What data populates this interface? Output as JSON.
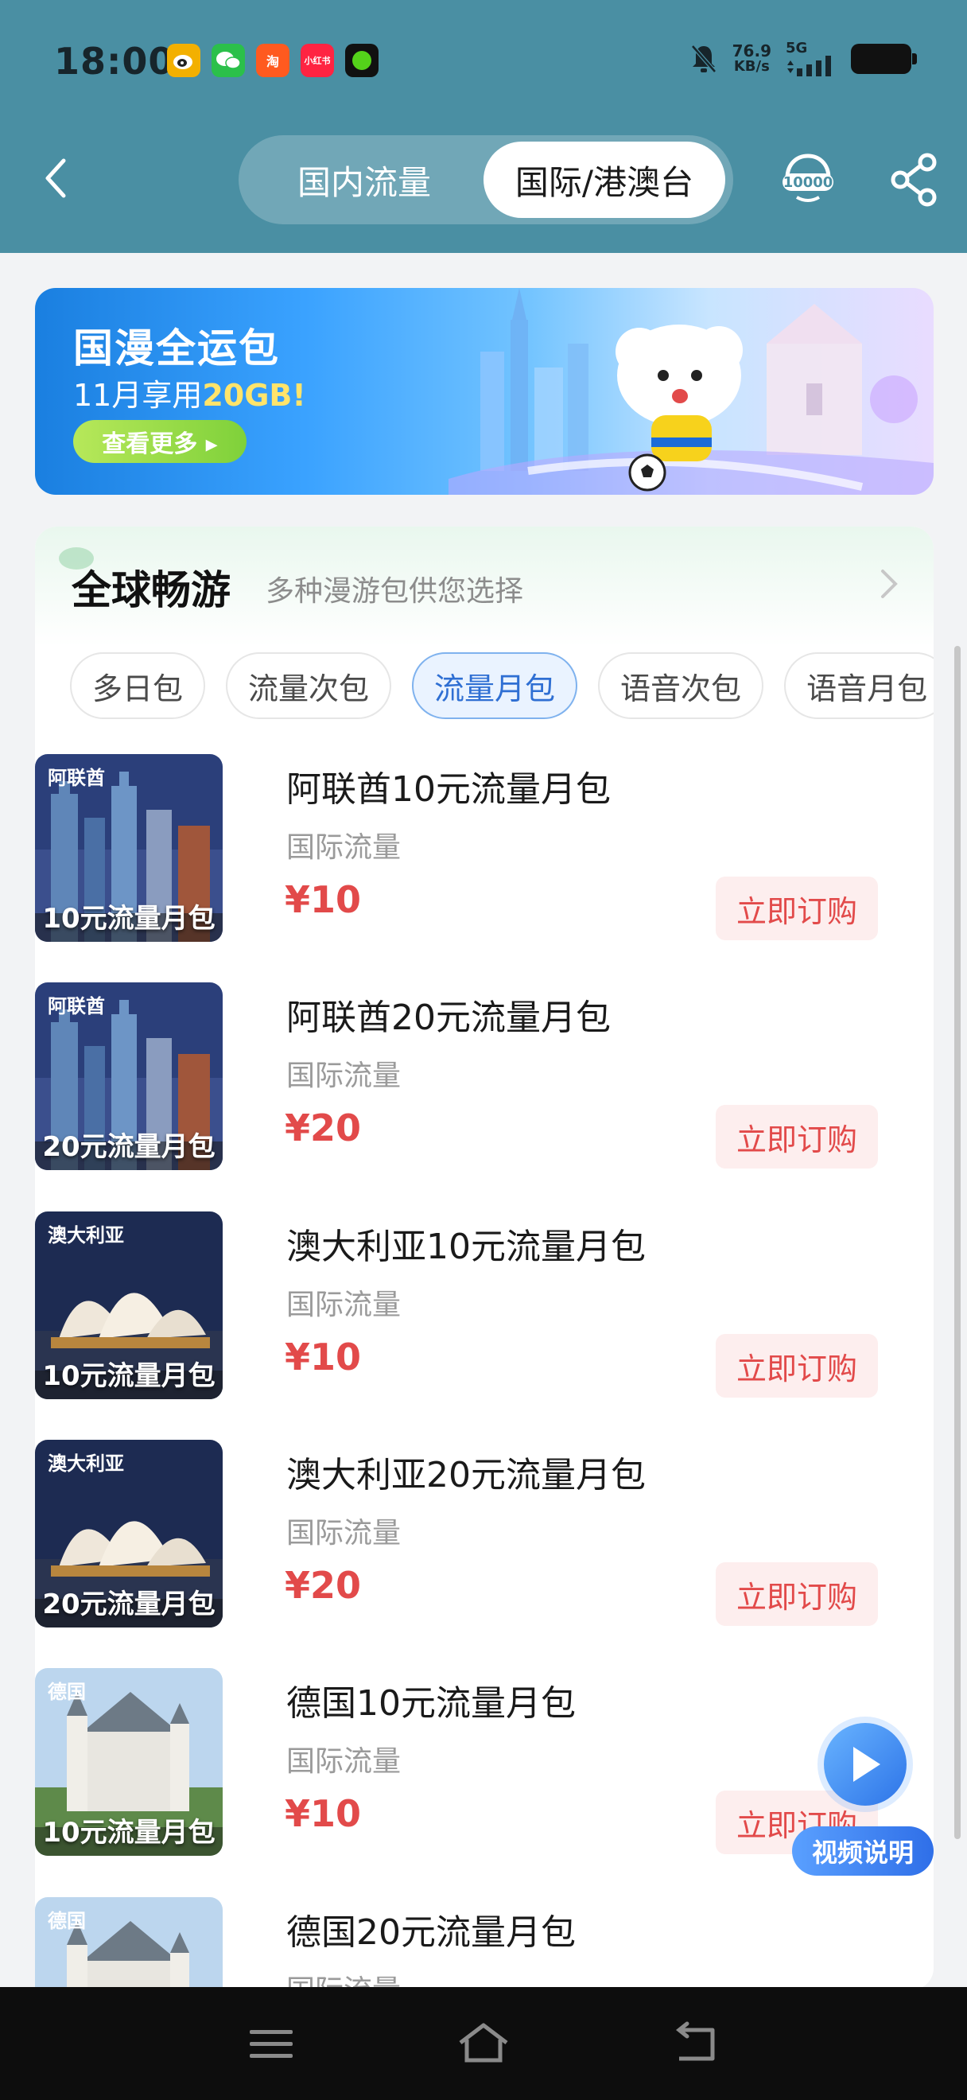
{
  "status_bar": {
    "time": "18:00",
    "app_icons": [
      "weibo",
      "wechat",
      "taobao",
      "xiaohongshu",
      "green-dot-app"
    ],
    "net_speed_value": "76.9",
    "net_speed_unit": "KB/s",
    "network": "5G",
    "icons": [
      "mute-icon",
      "signal-icon",
      "battery-icon"
    ]
  },
  "header": {
    "tabs": [
      "国内流量",
      "国际/港澳台"
    ],
    "active_tab": "国际/港澳台",
    "hotline": "10000",
    "colors": {
      "bar": "#4a8fa3",
      "active_tab_bg": "#ffffff"
    }
  },
  "banner": {
    "title": "国漫全运包",
    "subtitle_prefix": "11月享用",
    "subtitle_highlight": "20GB!",
    "more_label": "查看更多 ▸"
  },
  "section": {
    "title": "全球畅游",
    "subtitle": "多种漫游包供您选择",
    "chips": [
      "多日包",
      "流量次包",
      "流量月包",
      "语音次包",
      "语音月包"
    ],
    "active_chip": "流量月包"
  },
  "products": [
    {
      "region_tag": "阿联酋",
      "thumb_caption": "10元流量月包",
      "title": "阿联酋10元流量月包",
      "type": "国际流量",
      "price": "¥10",
      "button": "立即订购"
    },
    {
      "region_tag": "阿联酋",
      "thumb_caption": "20元流量月包",
      "title": "阿联酋20元流量月包",
      "type": "国际流量",
      "price": "¥20",
      "button": "立即订购"
    },
    {
      "region_tag": "澳大利亚",
      "thumb_caption": "10元流量月包",
      "title": "澳大利亚10元流量月包",
      "type": "国际流量",
      "price": "¥10",
      "button": "立即订购"
    },
    {
      "region_tag": "澳大利亚",
      "thumb_caption": "20元流量月包",
      "title": "澳大利亚20元流量月包",
      "type": "国际流量",
      "price": "¥20",
      "button": "立即订购"
    },
    {
      "region_tag": "德国",
      "thumb_caption": "10元流量月包",
      "title": "德国10元流量月包",
      "type": "国际流量",
      "price": "¥10",
      "button": "立即订购"
    },
    {
      "region_tag": "德国",
      "thumb_caption": "",
      "title": "德国20元流量月包",
      "type": "国际流量",
      "price": "",
      "button": ""
    }
  ],
  "float_button": {
    "label": "视频说明"
  },
  "nav_bar": {
    "buttons": [
      "menu",
      "home",
      "back"
    ]
  },
  "colors": {
    "price": "#e24a4a",
    "buy_bg": "#fdeeee",
    "chip_active": "#2f6fd3"
  }
}
